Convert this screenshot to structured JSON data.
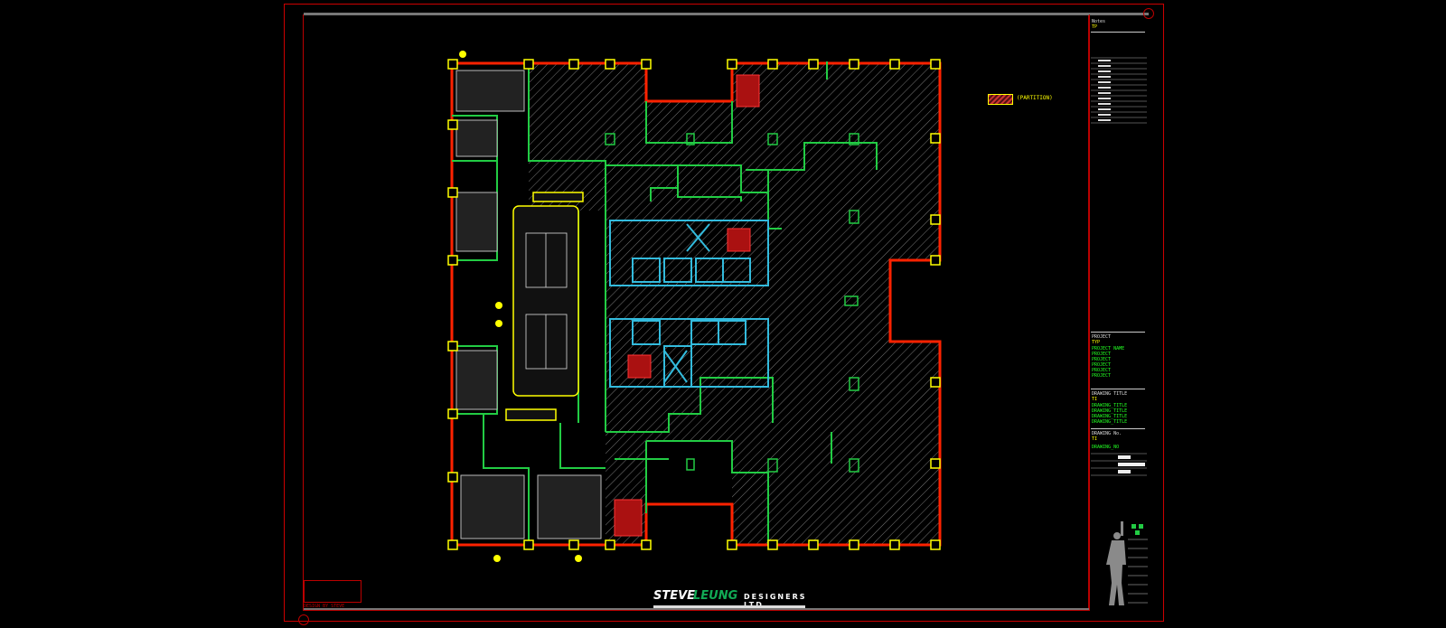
{
  "notes": {
    "heading": "Notes",
    "sub": "TP"
  },
  "legend": {
    "label": "(PARTITION)"
  },
  "title_block": {
    "project_heading": "PROJECT",
    "project_code": "TYP",
    "project_lines": [
      "PROJECT NAME",
      "PROJECT",
      "PROJECT",
      "PROJECT",
      "PROJECT",
      "PROJECT"
    ],
    "drawing_title_heading": "DRAWING TITLE",
    "drawing_title_code": "TI",
    "drawing_title_lines": [
      "DRAWING_TITLE",
      "DRAWING_TITLE",
      "DRAWING_TITLE",
      "DRAWING_TITLE"
    ],
    "drawing_no_heading": "DRAWING No.",
    "drawing_no_code": "TI",
    "drawing_no_value": "DRAWING_NO"
  },
  "stamp": {
    "text": "DESIGN BY STEVE"
  },
  "brand": {
    "steve": "STEVE",
    "leung": "LEUNG",
    "designers": "DESIGNERS LTD"
  },
  "colors": {
    "wall": "#ff2200",
    "column": "#ffff00",
    "partition": "#22cc44",
    "core": "#33bbdd",
    "hatch": "#888888",
    "frame": "#cc0000"
  }
}
